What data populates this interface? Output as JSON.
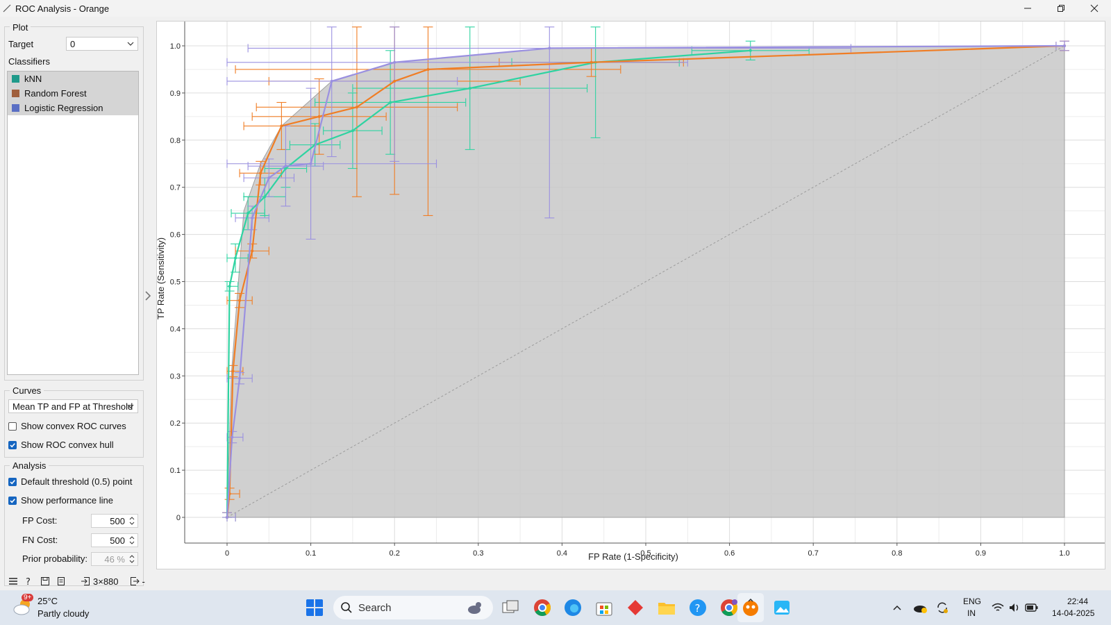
{
  "window": {
    "title": "ROC Analysis - Orange"
  },
  "plot_box": {
    "title": "Plot",
    "target_label": "Target",
    "target_value": "0",
    "classifiers_label": "Classifiers",
    "classifiers": [
      {
        "name": "kNN",
        "color": "#1f9a8a"
      },
      {
        "name": "Random Forest",
        "color": "#a05f3c"
      },
      {
        "name": "Logistic Regression",
        "color": "#5a6fc4"
      }
    ]
  },
  "curves_box": {
    "title": "Curves",
    "curve_mode": "Mean TP and FP at Threshold",
    "show_convex_curves": {
      "label": "Show convex ROC curves",
      "checked": false
    },
    "show_convex_hull": {
      "label": "Show ROC convex hull",
      "checked": true
    }
  },
  "analysis_box": {
    "title": "Analysis",
    "default_threshold": {
      "label": "Default threshold (0.5) point",
      "checked": true
    },
    "performance_line": {
      "label": "Show performance line",
      "checked": true
    },
    "fp_cost": {
      "label": "FP Cost:",
      "value": "500"
    },
    "fn_cost": {
      "label": "FN Cost:",
      "value": "500"
    },
    "prior": {
      "label": "Prior probability:",
      "value": "46 %"
    }
  },
  "status_bar": {
    "data_info": "3×880",
    "output_info": "-"
  },
  "chart_data": {
    "type": "line",
    "title": "",
    "xlabel": "FP Rate (1-Specificity)",
    "ylabel": "TP Rate (Sensitivity)",
    "xlim": [
      0,
      1
    ],
    "ylim": [
      0,
      1
    ],
    "x_ticks": [
      "0",
      "0.1",
      "0.2",
      "0.3",
      "0.4",
      "0.5",
      "0.6",
      "0.7",
      "0.8",
      "0.9",
      "1.0"
    ],
    "y_ticks": [
      "0",
      "0.1",
      "0.2",
      "0.3",
      "0.4",
      "0.5",
      "0.6",
      "0.7",
      "0.8",
      "0.9",
      "1.0"
    ],
    "grid": true,
    "colors": {
      "kNN": "#2ed3a1",
      "Random Forest": "#f07d24",
      "Logistic Regression": "#9a90e0",
      "hull": "#c8c8c8"
    },
    "hull": {
      "x": [
        0,
        0.005,
        0.02,
        0.04,
        0.065,
        0.125,
        0.2,
        0.385,
        1.0,
        1.0
      ],
      "y": [
        0,
        0.3,
        0.65,
        0.75,
        0.83,
        0.925,
        0.965,
        0.995,
        1.0,
        0
      ]
    },
    "series": [
      {
        "name": "kNN",
        "x": [
          0,
          0.003,
          0.01,
          0.025,
          0.045,
          0.07,
          0.105,
          0.15,
          0.195,
          0.29,
          0.44,
          0.625
        ],
        "y": [
          0,
          0.49,
          0.55,
          0.645,
          0.68,
          0.74,
          0.79,
          0.82,
          0.88,
          0.91,
          0.965,
          0.99
        ],
        "err_x": [
          0.01,
          0.01,
          0.015,
          0.02,
          0.025,
          0.025,
          0.03,
          0.035,
          0.09,
          0.14,
          0.1,
          0.07
        ],
        "err_y": [
          0.01,
          0.01,
          0.03,
          0.035,
          0.04,
          0.04,
          0.045,
          0.08,
          0.11,
          0.13,
          0.16,
          0.02
        ]
      },
      {
        "name": "Random Forest",
        "x": [
          0,
          0.003,
          0.007,
          0.015,
          0.03,
          0.04,
          0.065,
          0.11,
          0.155,
          0.2,
          0.24,
          0.435,
          1.0
        ],
        "y": [
          0,
          0.05,
          0.31,
          0.46,
          0.565,
          0.73,
          0.83,
          0.85,
          0.87,
          0.925,
          0.95,
          0.965,
          1.0
        ],
        "err_x": [
          0.01,
          0.012,
          0.012,
          0.015,
          0.02,
          0.025,
          0.045,
          0.08,
          0.12,
          0.15,
          0.23,
          0.11,
          0.01
        ],
        "err_y": [
          0.01,
          0.012,
          0.012,
          0.015,
          0.015,
          0.025,
          0.05,
          0.08,
          0.19,
          0.24,
          0.31,
          0.03,
          0.01
        ]
      },
      {
        "name": "Logistic Regression",
        "x": [
          0,
          0.006,
          0.015,
          0.03,
          0.05,
          0.07,
          0.1,
          0.125,
          0.2,
          0.385,
          1.0
        ],
        "y": [
          0,
          0.17,
          0.295,
          0.635,
          0.72,
          0.745,
          0.75,
          0.925,
          0.965,
          0.995,
          1.0
        ],
        "err_x": [
          0.01,
          0.013,
          0.015,
          0.02,
          0.03,
          0.045,
          0.15,
          0.15,
          0.35,
          0.36,
          0.01
        ],
        "err_y": [
          0.01,
          0.012,
          0.012,
          0.025,
          0.04,
          0.085,
          0.16,
          0.16,
          0.21,
          0.36,
          0.01
        ]
      }
    ]
  },
  "taskbar": {
    "weather_temp": "25°C",
    "weather_desc": "Partly cloudy",
    "weather_badge": "9+",
    "search_label": "Search",
    "lang_1": "ENG",
    "lang_2": "IN",
    "time": "22:44",
    "date": "14-04-2025"
  }
}
